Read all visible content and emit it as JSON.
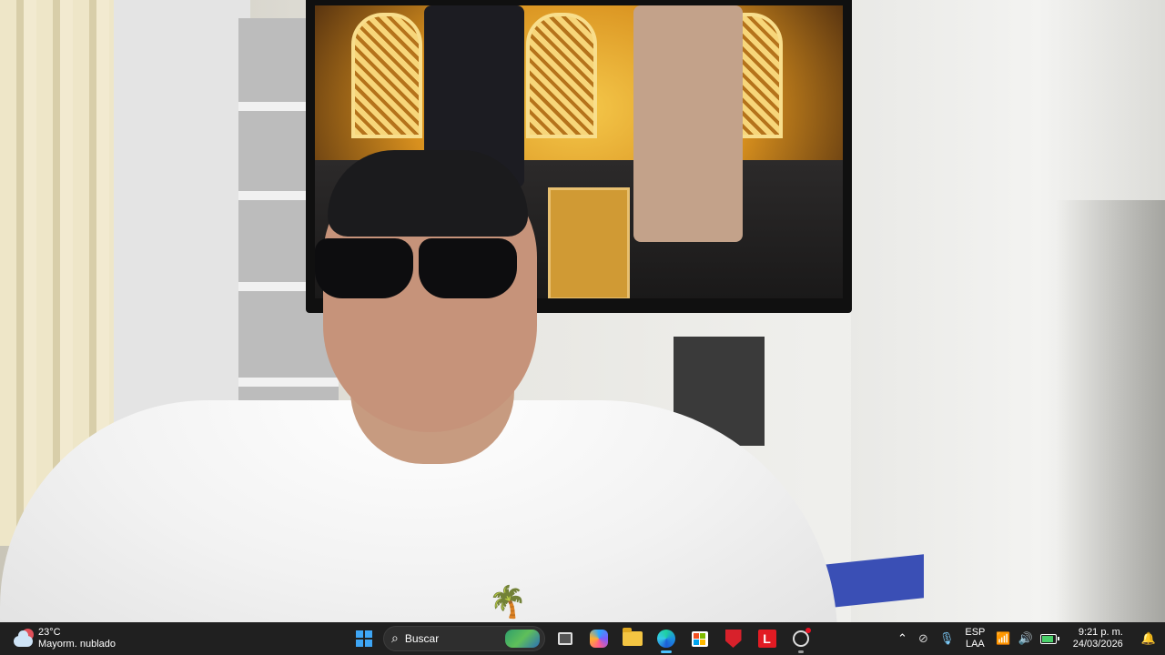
{
  "weather": {
    "temperature": "23°C",
    "condition": "Mayorm. nublado",
    "icon": "partly-cloudy-night-icon"
  },
  "taskbar": {
    "start": {
      "icon": "windows-start-icon"
    },
    "search": {
      "placeholder": "Buscar",
      "icon": "search-icon"
    },
    "apps": [
      {
        "name": "task-view",
        "icon": "task-view-icon",
        "running": false
      },
      {
        "name": "copilot",
        "icon": "copilot-icon",
        "running": false
      },
      {
        "name": "file-explorer",
        "icon": "folder-icon",
        "running": false
      },
      {
        "name": "edge",
        "icon": "edge-icon",
        "running": true
      },
      {
        "name": "microsoft-store",
        "icon": "store-icon",
        "running": false
      },
      {
        "name": "mcafee",
        "icon": "mcafee-shield-icon",
        "running": false
      },
      {
        "name": "lenovo",
        "icon": "lenovo-l-icon",
        "running": false
      },
      {
        "name": "camera",
        "icon": "camera-icon",
        "running": true,
        "badge": true
      }
    ]
  },
  "tray": {
    "language_line1": "ESP",
    "language_line2": "LAA",
    "time": "9:21 p. m.",
    "date": "24/03/2026"
  },
  "colors": {
    "taskbar_bg": "#202020",
    "accent": "#4cc2ff",
    "badge": "#e81123"
  }
}
